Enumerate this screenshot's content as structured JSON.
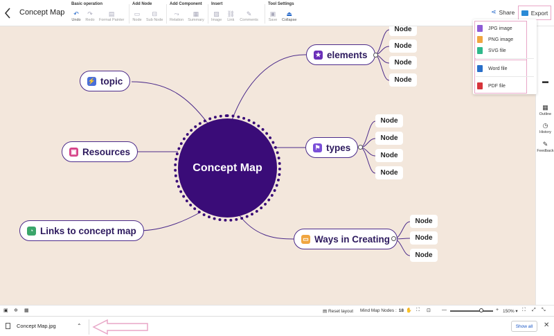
{
  "header": {
    "back_icon": "chevron-left-icon",
    "title": "Concept Map",
    "groups": [
      {
        "label": "Basic operation",
        "items": [
          {
            "label": "Undo",
            "icon": "undo-icon",
            "active": true
          },
          {
            "label": "Redo",
            "icon": "redo-icon",
            "active": false
          },
          {
            "label": "Format Painter",
            "icon": "format-painter-icon",
            "active": false
          }
        ]
      },
      {
        "label": "Add Node",
        "items": [
          {
            "label": "Node",
            "icon": "node-icon",
            "active": false
          },
          {
            "label": "Sub Node",
            "icon": "sub-node-icon",
            "active": false
          }
        ]
      },
      {
        "label": "Add Component",
        "items": [
          {
            "label": "Relation",
            "icon": "relation-icon",
            "active": false
          },
          {
            "label": "Summary",
            "icon": "summary-icon",
            "active": false
          }
        ]
      },
      {
        "label": "Insert",
        "items": [
          {
            "label": "Image",
            "icon": "image-icon",
            "active": false
          },
          {
            "label": "Link",
            "icon": "link-icon",
            "active": false
          },
          {
            "label": "Comments",
            "icon": "comments-icon",
            "active": false
          }
        ]
      },
      {
        "label": "Tool Settings",
        "items": [
          {
            "label": "Save",
            "icon": "save-icon",
            "active": false
          },
          {
            "label": "Collapse",
            "icon": "collapse-icon",
            "active": true
          }
        ]
      }
    ],
    "share_label": "Share",
    "export_label": "Export"
  },
  "export_menu": {
    "items": [
      {
        "label": "JPG image",
        "color": "#8e5bd6"
      },
      {
        "label": "PNG image",
        "color": "#f0a640"
      },
      {
        "label": "SVG file",
        "color": "#2fb88a"
      },
      {
        "label": "Word file",
        "color": "#2a6fc9"
      },
      {
        "label": "PDF file",
        "color": "#d6343b"
      }
    ]
  },
  "mindmap": {
    "central": "Concept Map",
    "topics": {
      "elements": {
        "label": "elements",
        "icon_color": "#6a2fb8"
      },
      "topic": {
        "label": "topic",
        "icon_color": "#4a6fd8"
      },
      "resources": {
        "label": "Resources",
        "icon_color": "#d6458a"
      },
      "types": {
        "label": "types",
        "icon_color": "#7a4fd8"
      },
      "links": {
        "label": "Links to concept map",
        "icon_color": "#3aa66a"
      },
      "ways": {
        "label": "Ways in Creating",
        "icon_color": "#f0a640"
      }
    },
    "child_label": "Node",
    "colors": {
      "central": "#3a0c78",
      "line": "#4b2a8a",
      "canvas": "#f3e7dc"
    }
  },
  "right_sidebar": {
    "items": [
      {
        "label": "Outline",
        "icon": "outline-icon"
      },
      {
        "label": "History",
        "icon": "history-icon"
      },
      {
        "label": "Feedback",
        "icon": "feedback-icon"
      }
    ]
  },
  "statusbar": {
    "reset_label": "Reset layout",
    "nodes_label": "Mind Map Nodes :",
    "nodes_count": "18",
    "zoom": "150%",
    "zoom_fraction": 0.72
  },
  "download_bar": {
    "filename": "Concept Map.jpg",
    "show_all": "Show all"
  }
}
